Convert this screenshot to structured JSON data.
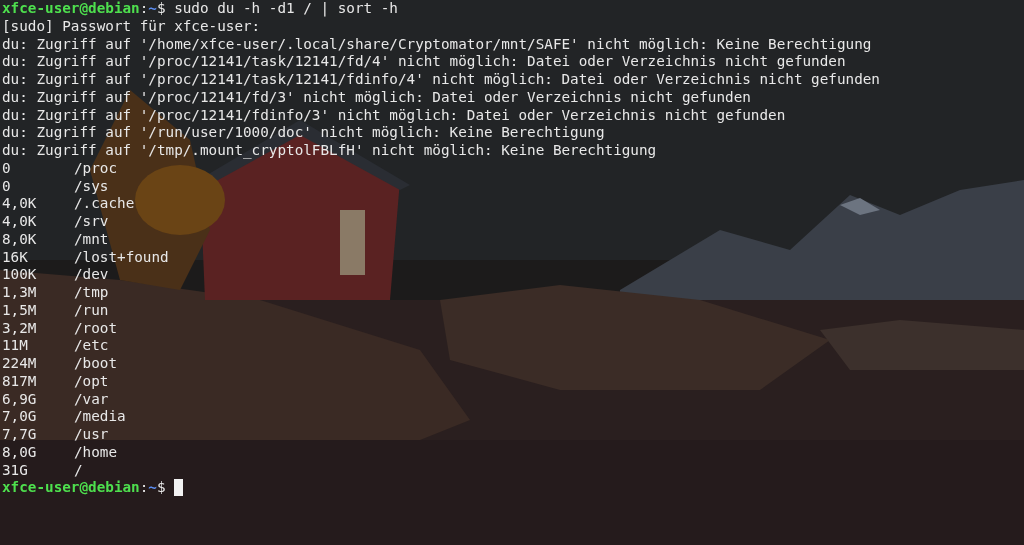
{
  "terminal": {
    "lines": [
      {
        "kind": "prompt",
        "user_host": "xfce-user@debian",
        "separator": ":",
        "path": "~",
        "symbol": "$",
        "command": "sudo du -h -d1 / | sort -h"
      },
      {
        "kind": "output",
        "text": "[sudo] Passwort für xfce-user:"
      },
      {
        "kind": "output",
        "text": "du: Zugriff auf '/home/xfce-user/.local/share/Cryptomator/mnt/SAFE' nicht möglich: Keine Berechtigung"
      },
      {
        "kind": "output",
        "text": "du: Zugriff auf '/proc/12141/task/12141/fd/4' nicht möglich: Datei oder Verzeichnis nicht gefunden"
      },
      {
        "kind": "output",
        "text": "du: Zugriff auf '/proc/12141/task/12141/fdinfo/4' nicht möglich: Datei oder Verzeichnis nicht gefunden"
      },
      {
        "kind": "output",
        "text": "du: Zugriff auf '/proc/12141/fd/3' nicht möglich: Datei oder Verzeichnis nicht gefunden"
      },
      {
        "kind": "output",
        "text": "du: Zugriff auf '/proc/12141/fdinfo/3' nicht möglich: Datei oder Verzeichnis nicht gefunden"
      },
      {
        "kind": "output",
        "text": "du: Zugriff auf '/run/user/1000/doc' nicht möglich: Keine Berechtigung"
      },
      {
        "kind": "output",
        "text": "du: Zugriff auf '/tmp/.mount_cryptolFBLfH' nicht möglich: Keine Berechtigung"
      },
      {
        "kind": "usage",
        "size": "0",
        "path": "/proc"
      },
      {
        "kind": "usage",
        "size": "0",
        "path": "/sys"
      },
      {
        "kind": "usage",
        "size": "4,0K",
        "path": "/.cache"
      },
      {
        "kind": "usage",
        "size": "4,0K",
        "path": "/srv"
      },
      {
        "kind": "usage",
        "size": "8,0K",
        "path": "/mnt"
      },
      {
        "kind": "usage",
        "size": "16K",
        "path": "/lost+found"
      },
      {
        "kind": "usage",
        "size": "100K",
        "path": "/dev"
      },
      {
        "kind": "usage",
        "size": "1,3M",
        "path": "/tmp"
      },
      {
        "kind": "usage",
        "size": "1,5M",
        "path": "/run"
      },
      {
        "kind": "usage",
        "size": "3,2M",
        "path": "/root"
      },
      {
        "kind": "usage",
        "size": "11M",
        "path": "/etc"
      },
      {
        "kind": "usage",
        "size": "224M",
        "path": "/boot"
      },
      {
        "kind": "usage",
        "size": "817M",
        "path": "/opt"
      },
      {
        "kind": "usage",
        "size": "6,9G",
        "path": "/var"
      },
      {
        "kind": "usage",
        "size": "7,0G",
        "path": "/media"
      },
      {
        "kind": "usage",
        "size": "7,7G",
        "path": "/usr"
      },
      {
        "kind": "usage",
        "size": "8,0G",
        "path": "/home"
      },
      {
        "kind": "usage",
        "size": "31G",
        "path": "/"
      },
      {
        "kind": "prompt",
        "user_host": "xfce-user@debian",
        "separator": ":",
        "path": "~",
        "symbol": "$",
        "cursor": true
      }
    ]
  }
}
